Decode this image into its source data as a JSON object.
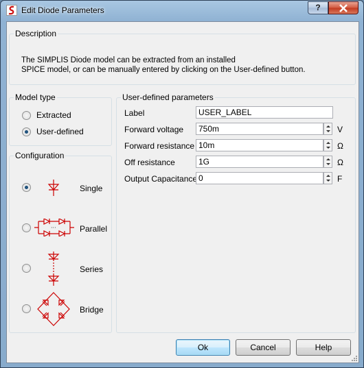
{
  "window": {
    "title": "Edit Diode Parameters",
    "help_glyph": "?",
    "close_glyph": "x"
  },
  "description": {
    "title": "Description",
    "line1": "The SIMPLIS Diode model can be extracted from an installed",
    "line2": "SPICE model, or can be manually entered by clicking on the User-defined button."
  },
  "model_type": {
    "title": "Model type",
    "options": [
      {
        "label": "Extracted",
        "selected": false
      },
      {
        "label": "User-defined",
        "selected": true
      }
    ]
  },
  "configuration": {
    "title": "Configuration",
    "options": [
      {
        "label": "Single",
        "selected": true
      },
      {
        "label": "Parallel",
        "selected": false
      },
      {
        "label": "Series",
        "selected": false
      },
      {
        "label": "Bridge",
        "selected": false
      }
    ]
  },
  "user_params": {
    "title": "User-defined parameters",
    "rows": [
      {
        "label": "Label",
        "value": "USER_LABEL",
        "unit": ""
      },
      {
        "label": "Forward voltage",
        "value": "750m",
        "unit": "V"
      },
      {
        "label": "Forward resistance",
        "value": "10m",
        "unit": "Ω"
      },
      {
        "label": "Off resistance",
        "value": "1G",
        "unit": "Ω"
      },
      {
        "label": "Output Capacitance",
        "value": "0",
        "unit": "F"
      }
    ]
  },
  "buttons": {
    "ok": "Ok",
    "cancel": "Cancel",
    "help": "Help"
  },
  "colors": {
    "diode_symbol": "#cc0000",
    "title_gradient": "#a9c7e2",
    "close_button": "#c23a20"
  }
}
